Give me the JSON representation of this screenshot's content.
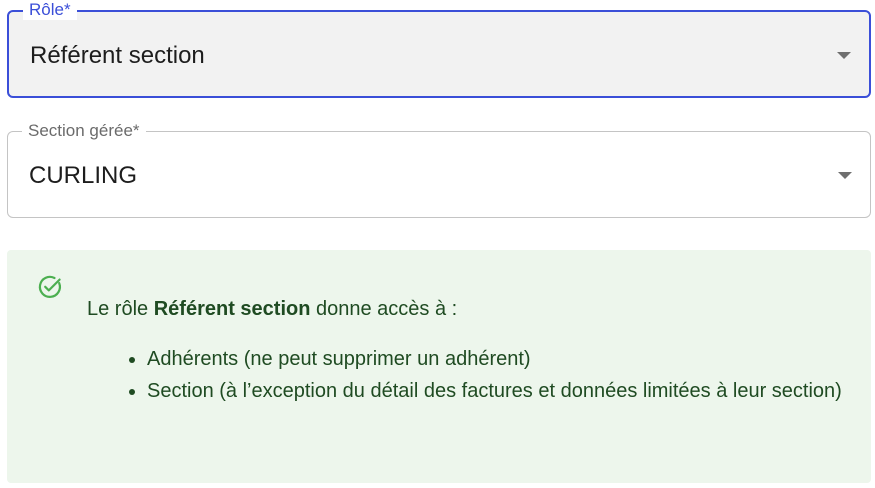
{
  "role_field": {
    "label": "Rôle*",
    "value": "Référent section"
  },
  "section_field": {
    "label": "Section gérée*",
    "value": "CURLING"
  },
  "alert": {
    "icon": "check-circle-icon",
    "text_prefix": "Le rôle ",
    "role_name": "Référent section",
    "text_suffix": " donne accès à :",
    "items": [
      "Adhérents (ne peut supprimer un adhérent)",
      "Section (à l’exception du détail des factures et données limitées à leur section)"
    ]
  },
  "colors": {
    "focus_border": "#3b4fd8",
    "alert_background": "#edf6ec",
    "alert_text": "#1f4b22",
    "alert_icon": "#4caf50"
  }
}
